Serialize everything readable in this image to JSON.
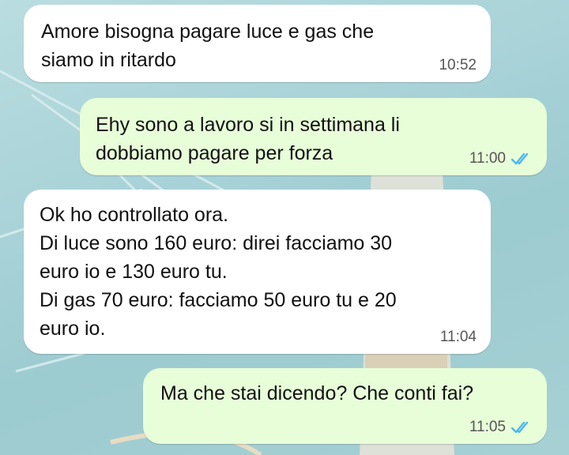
{
  "theme": {
    "incoming_bubble": "#ffffff",
    "outgoing_bubble": "#e7fed9",
    "read_ticks": "#4fb6ec",
    "time_color": "#555555"
  },
  "messages": [
    {
      "direction": "incoming",
      "text": "Amore bisogna pagare luce e gas che\nsiamo in ritardo",
      "time": "10:52"
    },
    {
      "direction": "outgoing",
      "text": "Ehy sono a lavoro si in settimana li\ndobbiamo pagare per forza",
      "time": "11:00",
      "status_icon": "double-check-read-icon"
    },
    {
      "direction": "incoming",
      "text": "Ok ho controllato ora.\nDi luce sono 160 euro: direi facciamo 30\neuro io e 130 euro tu.\nDi gas 70 euro: facciamo 50 euro tu e 20\neuro io.",
      "time": "11:04"
    },
    {
      "direction": "outgoing",
      "text": "Ma che stai dicendo? Che conti fai?",
      "time": "11:05",
      "status_icon": "double-check-read-icon"
    }
  ]
}
